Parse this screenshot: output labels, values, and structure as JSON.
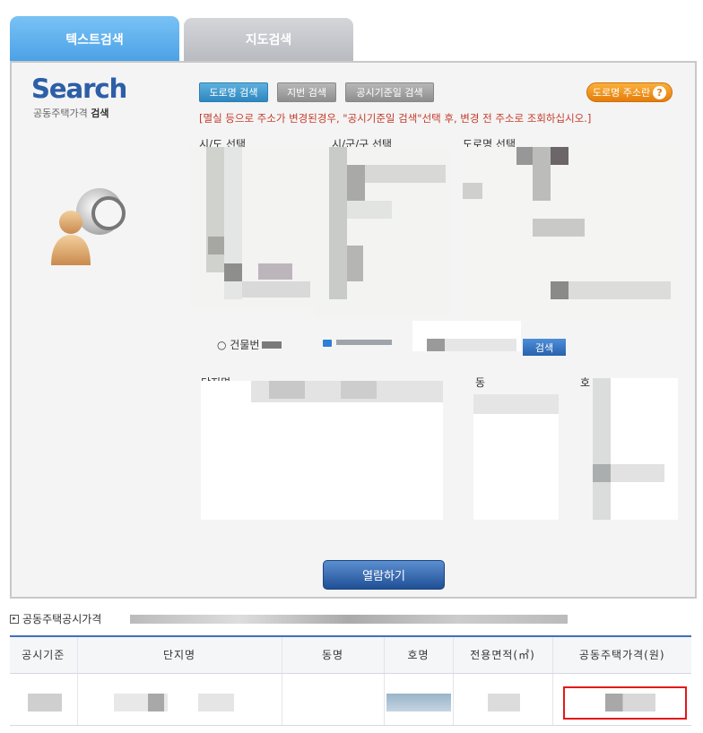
{
  "tabs": [
    {
      "label": "텍스트검색",
      "active": true
    },
    {
      "label": "지도검색",
      "active": false
    }
  ],
  "logo": {
    "title": "Search",
    "subtitle_prefix": "공동주택가격 ",
    "subtitle_bold": "검색"
  },
  "search_type_buttons": [
    {
      "label": "도로명 검색",
      "selected": true
    },
    {
      "label": "지번 검색",
      "selected": false
    },
    {
      "label": "공시기준일 검색",
      "selected": false
    }
  ],
  "address_help_button": {
    "label": "도로명 주소란",
    "icon": "question-icon"
  },
  "notice": "[멸실 등으로 주소가 변경된경우, \"공시기준일 검색\"선택 후, 변경 전 주소로 조회하십시오.]",
  "columns": {
    "sido": "시/도 선택",
    "sigungu": "시/군/구 선택",
    "road": "도로명 선택"
  },
  "building": {
    "radio_label": "○ 건물번",
    "search_button": "검색"
  },
  "result_columns": {
    "complex": "단지명",
    "dong": "동",
    "ho": "호"
  },
  "view_button": "열람하기",
  "section_title": "공동주택공시가격",
  "table": {
    "headers": [
      "공시기준",
      "단지명",
      "동명",
      "호명",
      "전용면적(㎡)",
      "공동주택가격(원)"
    ]
  },
  "colors": {
    "accent": "#3f72b8",
    "notice": "#c43b2a",
    "highlight": "#e31919"
  }
}
